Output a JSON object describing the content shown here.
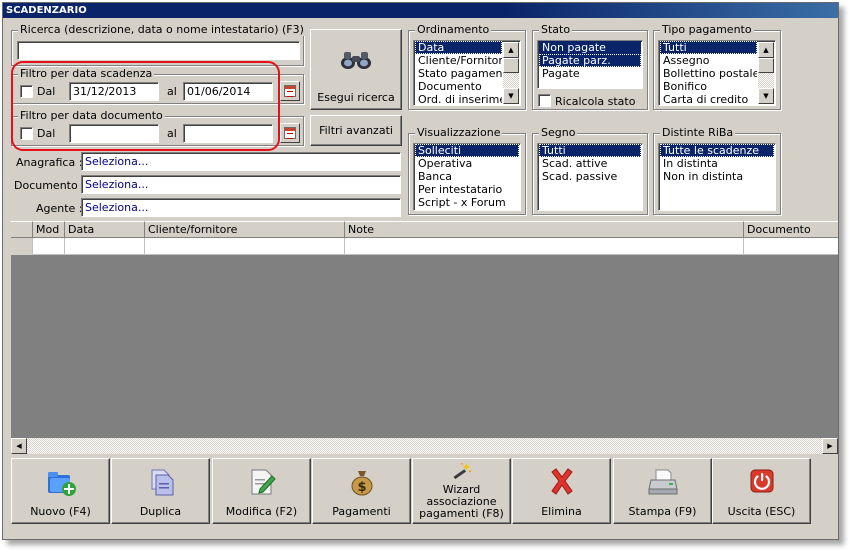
{
  "window": {
    "title": "SCADENZARIO"
  },
  "search": {
    "legend": "Ricerca (descrizione, data o nome intestatario) (F3)",
    "value": ""
  },
  "scadenza_filter": {
    "legend": "Filtro per data scadenza",
    "dal_label": "Dal",
    "dal_checked": false,
    "from": "31/12/2013",
    "al_label": "al",
    "to": "01/06/2014"
  },
  "documento_filter": {
    "legend": "Filtro per data documento",
    "dal_label": "Dal",
    "dal_checked": false,
    "from": "",
    "al_label": "al",
    "to": ""
  },
  "buttons": {
    "esegui": "Esegui ricerca",
    "filtri": "Filtri avanzati"
  },
  "lookups": [
    {
      "label": "Anagrafica :",
      "value": "Seleziona..."
    },
    {
      "label": "Documento :",
      "value": "Seleziona..."
    },
    {
      "label": "Agente :",
      "value": "Seleziona..."
    }
  ],
  "ordinamento": {
    "legend": "Ordinamento",
    "items": [
      "Data",
      "Cliente/Fornitore",
      "Stato pagamento",
      "Documento",
      "Ord. di inserimento"
    ],
    "selected": [
      0
    ]
  },
  "stato": {
    "legend": "Stato",
    "items": [
      "Non pagate",
      "Pagate parz.",
      "Pagate"
    ],
    "selected": [
      0,
      1
    ],
    "ricalcola_label": "Ricalcola stato",
    "ricalcola_checked": false
  },
  "tipo_pagamento": {
    "legend": "Tipo pagamento",
    "items": [
      "Tutti",
      "Assegno",
      "Bollettino postale",
      "Bonifico",
      "Carta di credito"
    ],
    "selected": [
      0
    ]
  },
  "visualizzazione": {
    "legend": "Visualizzazione",
    "items": [
      "Solleciti",
      "Operativa",
      "Banca",
      "Per intestatario",
      "Script - x Forum"
    ],
    "selected": [
      0
    ]
  },
  "segno": {
    "legend": "Segno",
    "items": [
      "Tutti",
      "Scad. attive",
      "Scad. passive"
    ],
    "selected": [
      0
    ]
  },
  "distinte": {
    "legend": "Distinte RiBa",
    "items": [
      "Tutte le scadenze",
      "In distinta",
      "Non in distinta"
    ],
    "selected": [
      0
    ]
  },
  "grid": {
    "columns": [
      "",
      "Mod",
      "Data",
      "Cliente/fornitore",
      "Note",
      "Documento"
    ]
  },
  "toolbar": {
    "nuovo": "Nuovo (F4)",
    "duplica": "Duplica",
    "modifica": "Modifica (F2)",
    "pagamenti": "Pagamenti",
    "wizard_1": "Wizard",
    "wizard_2": "associazione",
    "wizard_3": "pagamenti (F8)",
    "elimina": "Elimina",
    "stampa": "Stampa (F9)",
    "uscita": "Uscita (ESC)"
  },
  "colors": {
    "titlebar": "#0a246a",
    "selection": "#0a246a",
    "face": "#d4d0c8",
    "highlight_ring": "#e4111b",
    "link": "#000080"
  }
}
